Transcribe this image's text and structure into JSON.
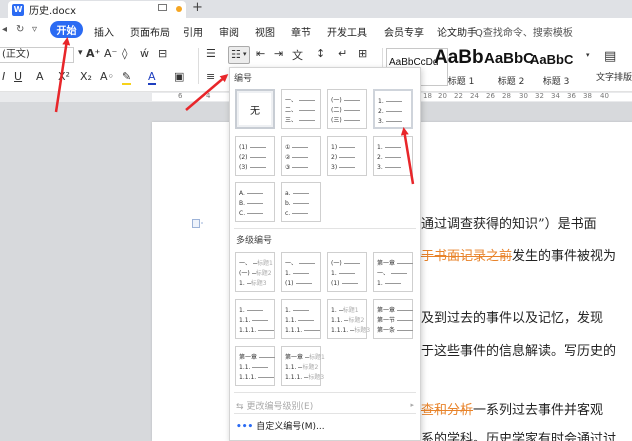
{
  "tab": {
    "title": "历史.docx",
    "icon_text": "W",
    "icon": "word-doc-icon"
  },
  "menubar": {
    "active": "开始",
    "items": [
      "插入",
      "页面布局",
      "引用",
      "审阅",
      "视图",
      "章节",
      "开发工具",
      "会员专享",
      "论文助手"
    ],
    "search": "Q查找命令、搜索模板"
  },
  "ribbon": {
    "font": "(正文)",
    "styles": [
      {
        "sample": "AaBbCcDd",
        "name": ""
      },
      {
        "sample": "AaBb",
        "name": "标题 1"
      },
      {
        "sample": "AaBbC",
        "name": "标题 2"
      },
      {
        "sample": "AaBbC",
        "name": "标题 3"
      }
    ],
    "layout_label": "文字排版"
  },
  "ruler": {
    "marks": [
      "6",
      "4",
      "18",
      "20",
      "22",
      "24",
      "26",
      "28",
      "30",
      "32",
      "34",
      "36",
      "38",
      "40"
    ]
  },
  "panel": {
    "title": "编号",
    "none_label": "无",
    "single_tiles": [
      {
        "rows": [
          [
            "一、",
            ""
          ],
          [
            "二、",
            ""
          ],
          [
            "三、",
            ""
          ]
        ]
      },
      {
        "rows": [
          [
            "(一)",
            ""
          ],
          [
            "(二)",
            ""
          ],
          [
            "(三)",
            ""
          ]
        ]
      },
      {
        "rows": [
          [
            "1.",
            ""
          ],
          [
            "2.",
            ""
          ],
          [
            "3.",
            ""
          ]
        ]
      },
      {
        "rows": [
          [
            "(1)",
            ""
          ],
          [
            "(2)",
            ""
          ],
          [
            "(3)",
            ""
          ]
        ]
      },
      {
        "rows": [
          [
            "①",
            ""
          ],
          [
            "②",
            ""
          ],
          [
            "③",
            ""
          ]
        ]
      },
      {
        "rows": [
          [
            "1)",
            ""
          ],
          [
            "2)",
            ""
          ],
          [
            "3)",
            ""
          ]
        ]
      },
      {
        "rows": [
          [
            "1.",
            ""
          ],
          [
            "2.",
            ""
          ],
          [
            "3.",
            ""
          ]
        ]
      },
      {
        "rows": [
          [
            "A.",
            ""
          ],
          [
            "B.",
            ""
          ],
          [
            "C.",
            ""
          ]
        ]
      },
      {
        "rows": [
          [
            "a.",
            ""
          ],
          [
            "b.",
            ""
          ],
          [
            "c.",
            ""
          ]
        ]
      }
    ],
    "multi_title": "多级编号",
    "multi_tiles": [
      {
        "rows": [
          [
            "一、",
            "标题1"
          ],
          [
            "(一)",
            "标题2"
          ],
          [
            "1.",
            "标题3"
          ]
        ]
      },
      {
        "rows": [
          [
            "一、",
            ""
          ],
          [
            "1.",
            ""
          ],
          [
            "(1)",
            ""
          ]
        ]
      },
      {
        "rows": [
          [
            "(一)",
            ""
          ],
          [
            "1.",
            ""
          ],
          [
            "(1)",
            ""
          ]
        ]
      },
      {
        "rows": [
          [
            "第一章",
            ""
          ],
          [
            "一、",
            ""
          ],
          [
            "1.",
            ""
          ]
        ]
      },
      {
        "rows": [
          [
            "1.",
            ""
          ],
          [
            "1.1.",
            ""
          ],
          [
            "1.1.1.",
            ""
          ]
        ]
      },
      {
        "rows": [
          [
            "1.",
            ""
          ],
          [
            "1.1.",
            ""
          ],
          [
            "1.1.1.",
            ""
          ]
        ]
      },
      {
        "rows": [
          [
            "1.",
            "标题1"
          ],
          [
            "1.1.",
            "标题2"
          ],
          [
            "1.1.1.",
            "标题3"
          ]
        ]
      },
      {
        "rows": [
          [
            "第一章",
            ""
          ],
          [
            "第一节",
            ""
          ],
          [
            "第一条",
            ""
          ]
        ]
      },
      {
        "rows": [
          [
            "第一章",
            ""
          ],
          [
            "1.1.",
            ""
          ],
          [
            "1.1.1.",
            ""
          ]
        ]
      },
      {
        "rows": [
          [
            "第一章",
            "标题1"
          ],
          [
            "1.1.",
            "标题2"
          ],
          [
            "1.1.1.",
            "标题3"
          ]
        ]
      }
    ],
    "change_level": "更改编号级别(E)",
    "custom": "自定义编号(M)..."
  },
  "document": {
    "lines": [
      {
        "parts": [
          {
            "t": "通过调查获得的知识”）是书面"
          }
        ]
      },
      {
        "parts": [
          {
            "t": "于书面记录之前",
            "style": "orange strike"
          },
          {
            "t": "发生的事件被视为"
          }
        ]
      },
      {
        "parts": [
          {
            "t": "及到过去的事件以及记忆，发现"
          }
        ]
      },
      {
        "parts": [
          {
            "t": "于这些事件的信息解读。写历史的"
          }
        ]
      },
      {
        "parts": [
          {
            "t": "查和分析",
            "style": "orange strike"
          },
          {
            "t": "一系列过去事件并客观"
          }
        ]
      },
      {
        "parts": [
          {
            "t": "系的学科。历史学家有时会通过讨"
          }
        ]
      }
    ]
  },
  "colors": {
    "accent": "#2b6bf3",
    "annotation": "#e8262a",
    "edit_mark": "#e8832a"
  }
}
